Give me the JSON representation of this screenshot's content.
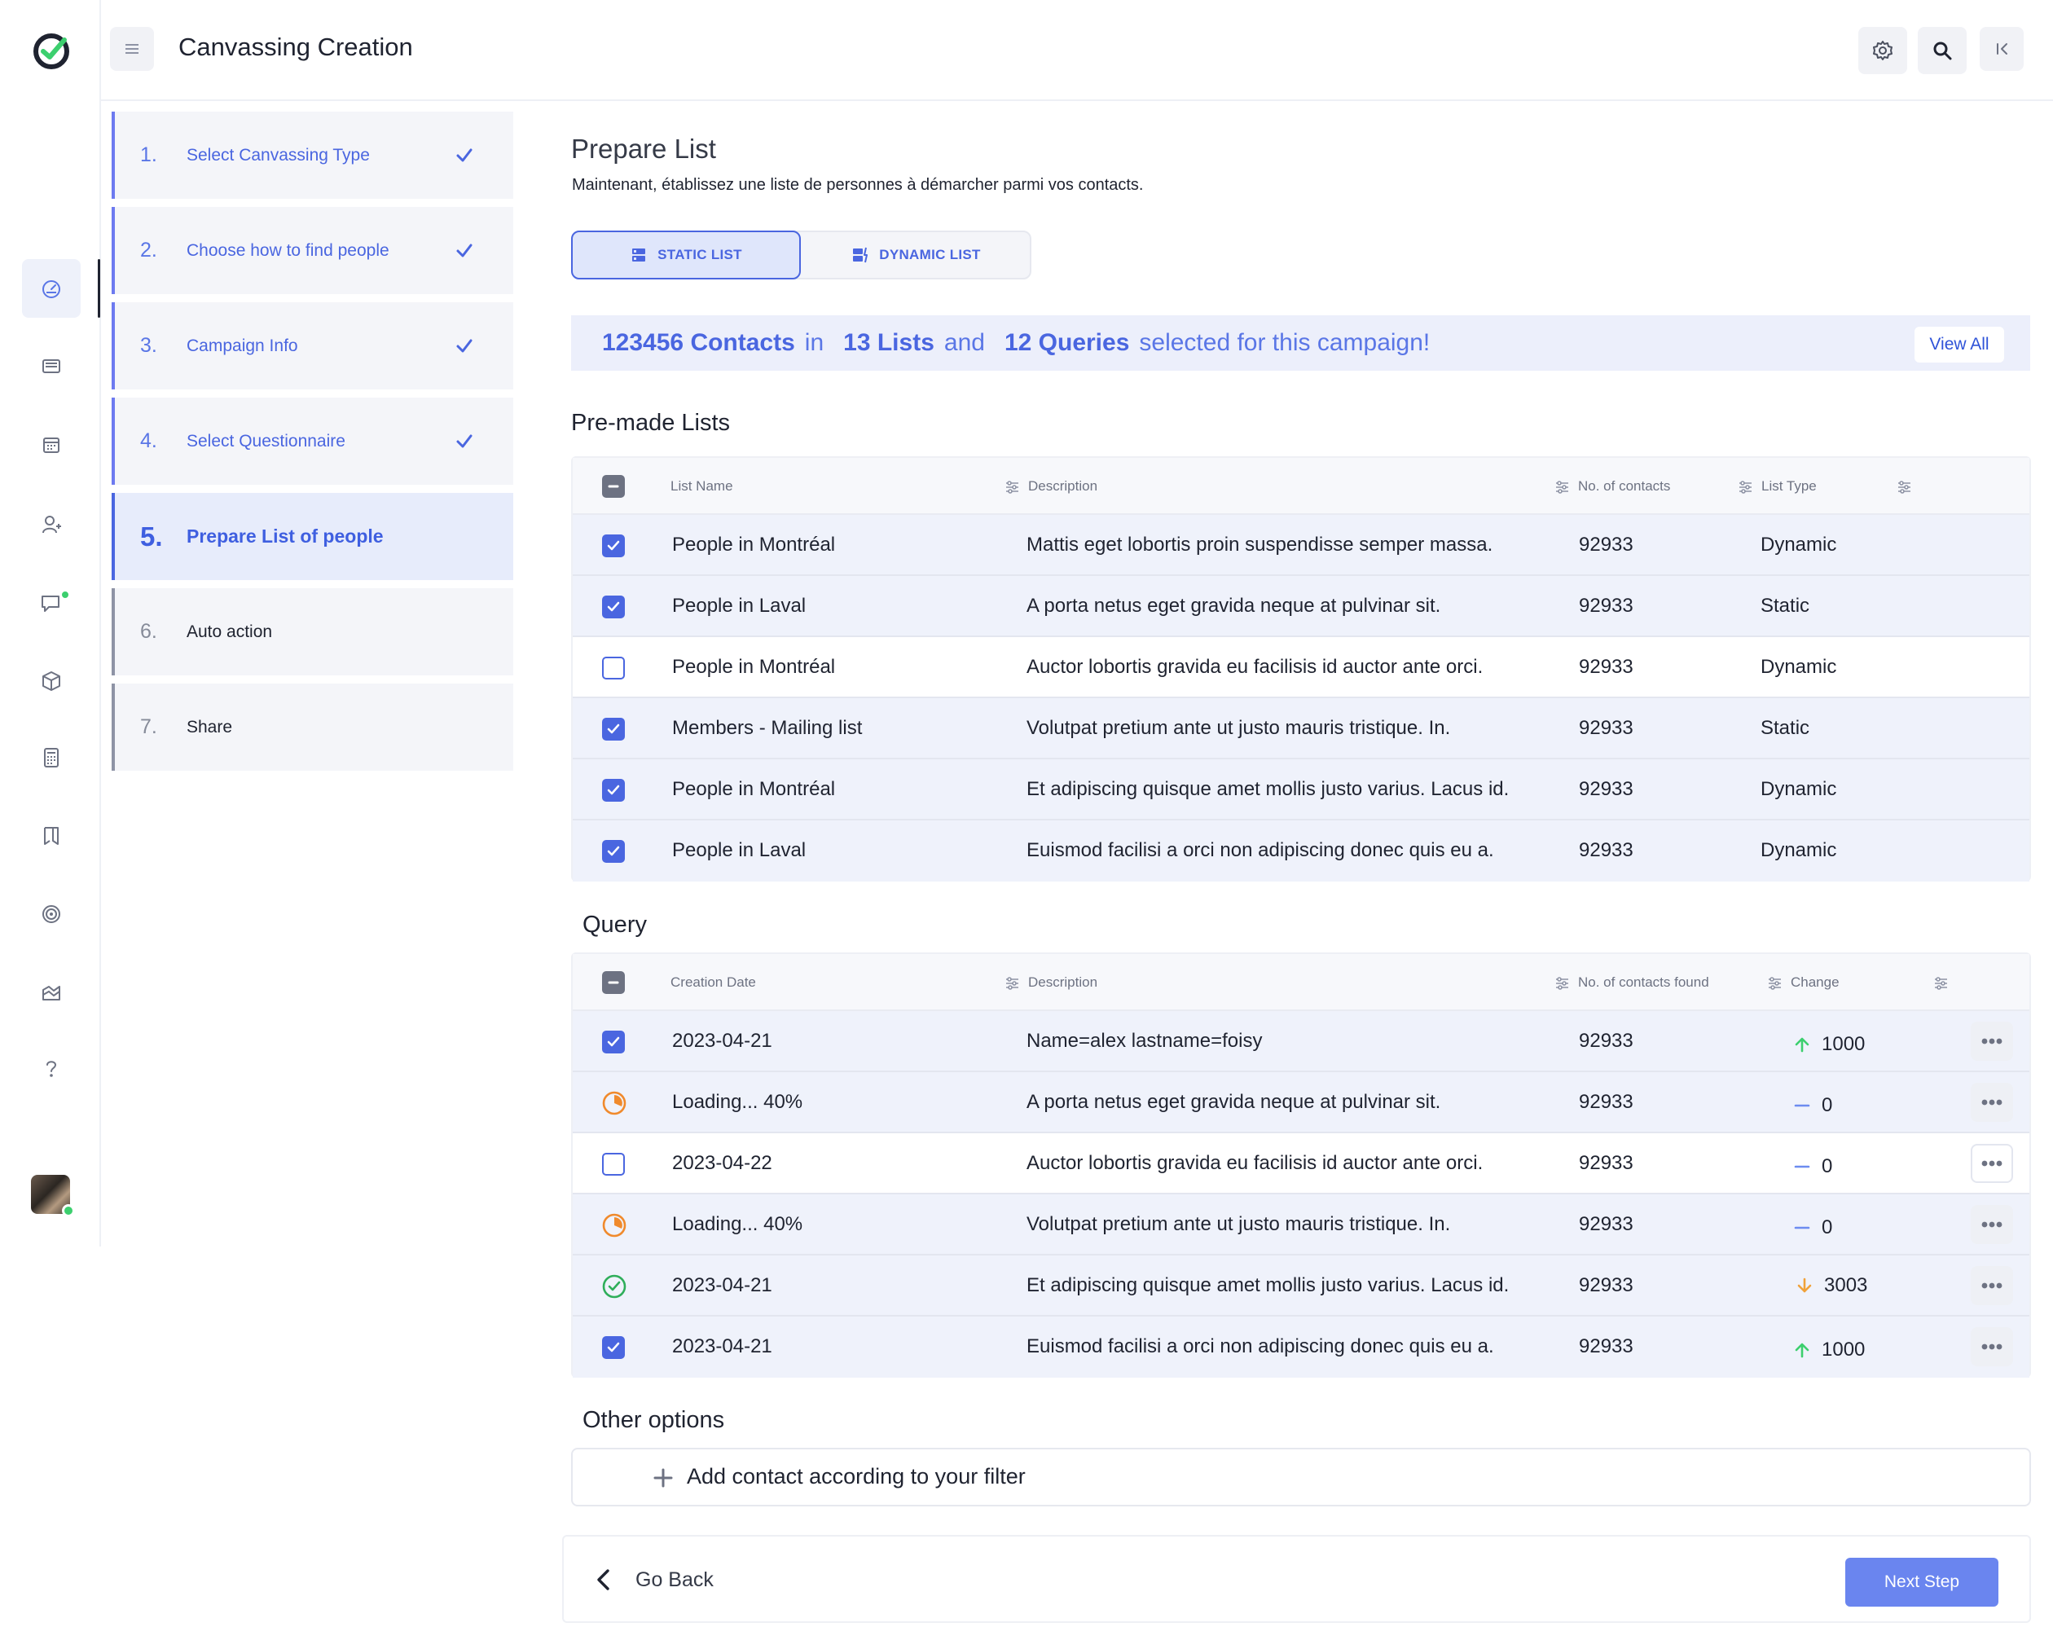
{
  "app": {
    "title": "Canvassing Creation"
  },
  "rail": {
    "items": [
      "dashboard-icon",
      "messages-icon",
      "calendar-icon",
      "contacts-icon",
      "chat-icon",
      "package-icon",
      "calculator-icon",
      "map-icon",
      "target-icon",
      "reports-icon",
      "help-icon"
    ],
    "active": "dashboard-icon"
  },
  "steps": [
    {
      "num": "1.",
      "label": "Select Canvassing Type",
      "state": "done"
    },
    {
      "num": "2.",
      "label": "Choose how to find people",
      "state": "done"
    },
    {
      "num": "3.",
      "label": "Campaign Info",
      "state": "done"
    },
    {
      "num": "4.",
      "label": "Select Questionnaire",
      "state": "done"
    },
    {
      "num": "5.",
      "label": "Prepare List of people",
      "state": "active"
    },
    {
      "num": "6.",
      "label": "Auto action",
      "state": "pending"
    },
    {
      "num": "7.",
      "label": "Share",
      "state": "pending"
    }
  ],
  "main": {
    "heading": "Prepare List",
    "subtitle": "Maintenant, établissez une liste de personnes à démarcher parmi vos contacts.",
    "toggle": {
      "static_label": "STATIC LIST",
      "dynamic_label": "DYNAMIC LIST",
      "selected": "static"
    },
    "summary": {
      "contacts": "123456 Contacts",
      "in": "in",
      "lists": "13 Lists",
      "and": "and",
      "queries": "12 Queries",
      "tail": "selected for this campaign!",
      "view_all": "View All"
    }
  },
  "premade": {
    "title": "Pre-made Lists",
    "headers": {
      "name": "List Name",
      "description": "Description",
      "contacts": "No. of contacts",
      "type": "List Type"
    },
    "rows": [
      {
        "name": "People in Montréal",
        "description": "Mattis eget lobortis proin suspendisse semper massa.",
        "contacts": "92933",
        "type": "Dynamic",
        "checked": true
      },
      {
        "name": "People in Laval",
        "description": "A porta netus eget gravida neque at pulvinar sit.",
        "contacts": "92933",
        "type": "Static",
        "checked": true
      },
      {
        "name": "People in Montréal",
        "description": "Auctor lobortis gravida eu facilisis id auctor ante orci.",
        "contacts": "92933",
        "type": "Dynamic",
        "checked": false
      },
      {
        "name": "Members - Mailing list",
        "description": "Volutpat pretium ante ut justo mauris tristique. In.",
        "contacts": "92933",
        "type": "Static",
        "checked": true
      },
      {
        "name": "People in Montréal",
        "description": "Et adipiscing quisque amet mollis justo varius. Lacus id.",
        "contacts": "92933",
        "type": "Dynamic",
        "checked": true
      },
      {
        "name": "People in Laval",
        "description": "Euismod facilisi a orci non adipiscing donec quis eu a.",
        "contacts": "92933",
        "type": "Dynamic",
        "checked": true
      }
    ]
  },
  "query": {
    "title": "Query",
    "headers": {
      "date": "Creation Date",
      "description": "Description",
      "found": "No. of contacts found",
      "change": "Change"
    },
    "rows": [
      {
        "status": "checked",
        "date": "2023-04-21",
        "description": "Name=alex lastname=foisy",
        "found": "92933",
        "change": "1000",
        "trend": "up"
      },
      {
        "status": "loading",
        "date": "Loading... 40%",
        "description": "A porta netus eget gravida neque at pulvinar sit.",
        "found": "92933",
        "change": "0",
        "trend": "flat"
      },
      {
        "status": "unchecked",
        "date": "2023-04-22",
        "description": "Auctor lobortis gravida eu facilisis id auctor ante orci.",
        "found": "92933",
        "change": "0",
        "trend": "flat"
      },
      {
        "status": "loading",
        "date": "Loading... 40%",
        "description": "Volutpat pretium ante ut justo mauris tristique. In.",
        "found": "92933",
        "change": "0",
        "trend": "flat"
      },
      {
        "status": "done",
        "date": "2023-04-21",
        "description": "Et adipiscing quisque amet mollis justo varius. Lacus id.",
        "found": "92933",
        "change": "3003",
        "trend": "down"
      },
      {
        "status": "checked",
        "date": "2023-04-21",
        "description": "Euismod facilisi a orci non adipiscing donec quis eu a.",
        "found": "92933",
        "change": "1000",
        "trend": "up"
      }
    ]
  },
  "other": {
    "title": "Other options",
    "add_filter": "Add contact according to your filter"
  },
  "footer": {
    "go_back": "Go Back",
    "next_step": "Next Step"
  },
  "colors": {
    "accent": "#4a66e0",
    "up": "#3ccf6e",
    "down": "#f0a23a",
    "flat": "#6d8cf0",
    "loading": "#f08a2c",
    "done": "#2fae5a"
  }
}
